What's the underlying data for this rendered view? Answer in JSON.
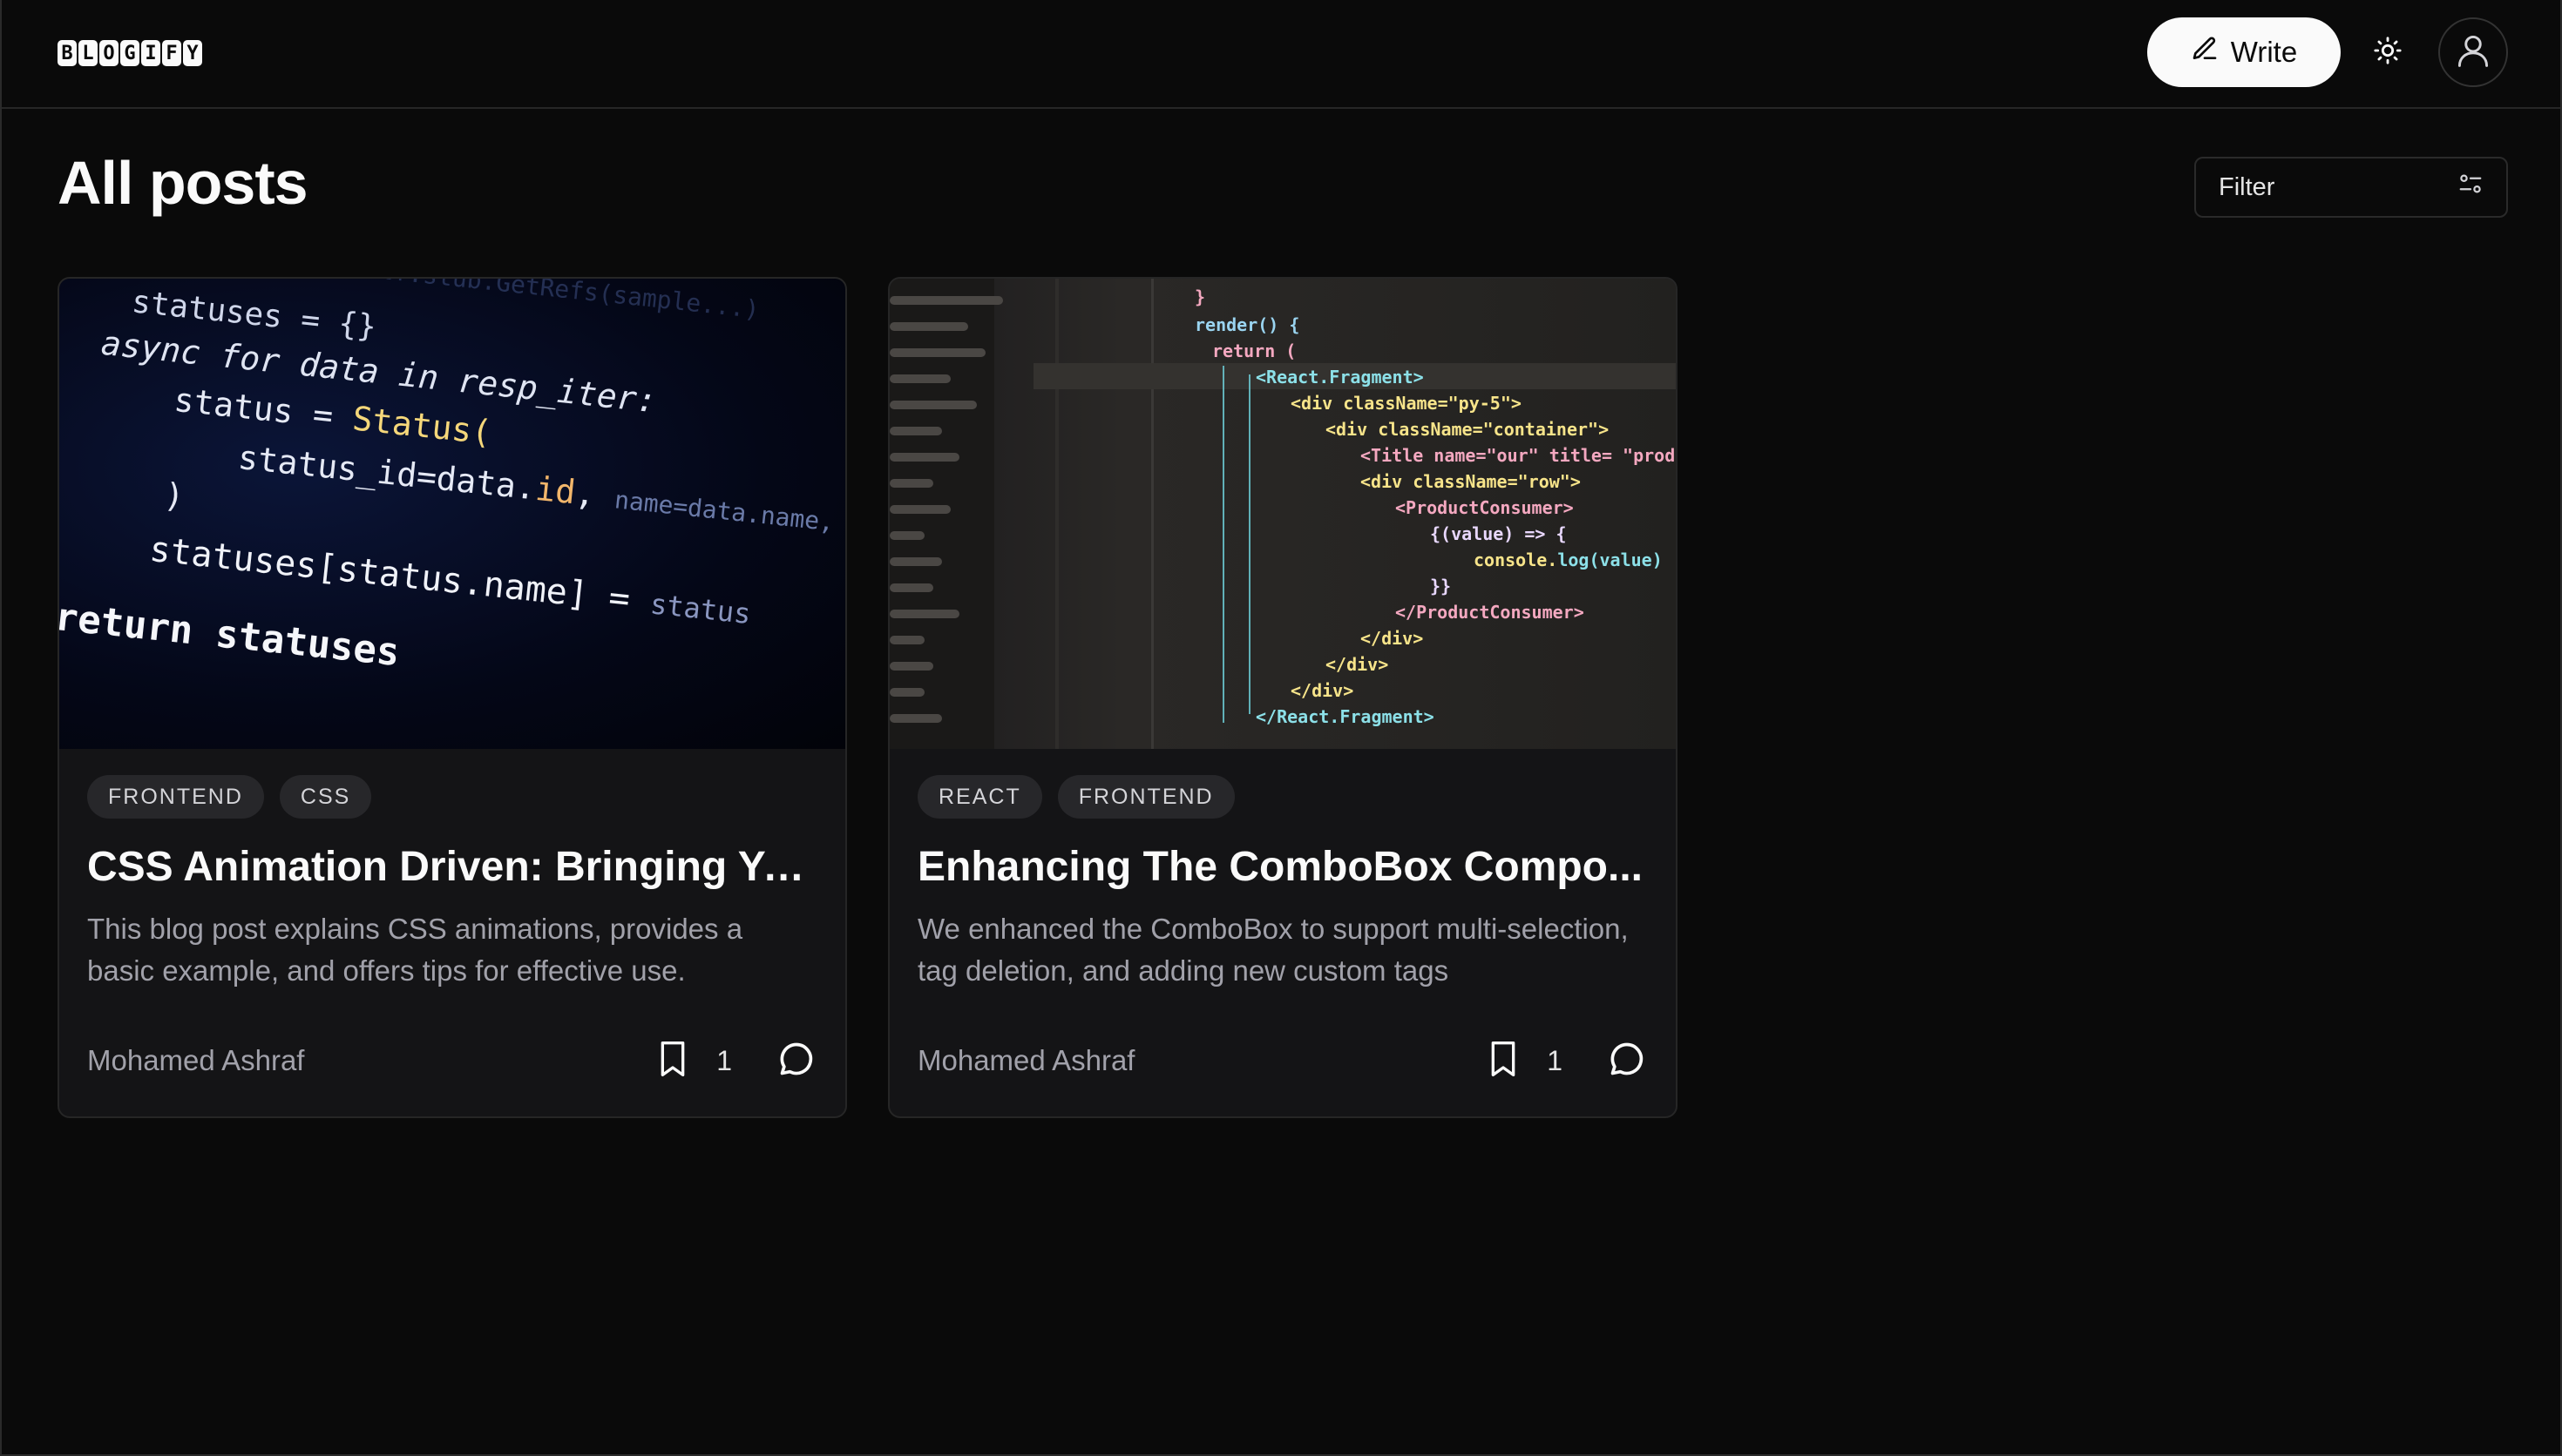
{
  "header": {
    "logo_letters": [
      "B",
      "L",
      "O",
      "G",
      "I",
      "F",
      "Y"
    ],
    "write_label": "Write"
  },
  "main": {
    "title": "All posts",
    "filter_label": "Filter"
  },
  "posts": [
    {
      "tags": [
        "FRONTEND",
        "CSS"
      ],
      "title": "CSS Animation Driven: Bringing Yo...",
      "description": "This blog post explains CSS animations, provides a basic example, and offers tips for effective use.",
      "author": "Mohamed Ashraf",
      "bookmarks": "1"
    },
    {
      "tags": [
        "REACT",
        "FRONTEND"
      ],
      "title": "Enhancing The ComboBox Compo...",
      "description": "We enhanced the ComboBox to support multi-selection, tag deletion, and adding new custom tags",
      "author": "Mohamed Ashraf",
      "bookmarks": "1"
    }
  ],
  "colors": {
    "background": "#0a0a0a",
    "card": "#141416",
    "tag_bg": "#27272a",
    "muted_text": "#a1a1aa",
    "primary_btn": "#fafafa"
  },
  "icons": {
    "write": "pencil-icon",
    "theme": "sun-icon",
    "avatar": "user-icon",
    "filter": "sliders-icon",
    "bookmark": "bookmark-icon",
    "comment": "comment-icon"
  }
}
